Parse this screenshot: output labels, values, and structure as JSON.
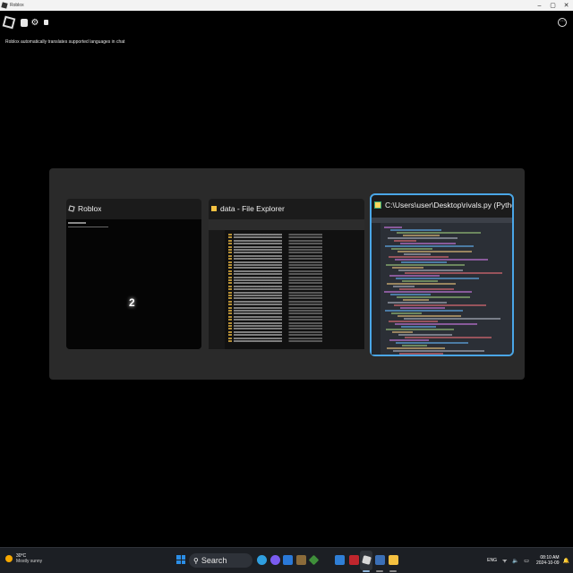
{
  "window": {
    "title": "Roblox",
    "controls": {
      "minimize": "–",
      "maximize": "▢",
      "close": "✕"
    }
  },
  "roblox_topbar": {
    "icons": [
      "roblox-menu-icon",
      "chat-icon",
      "settings-icon",
      "backpack-icon",
      "more-icon"
    ],
    "more_glyph": "⋯"
  },
  "notice": "Roblox automatically translates supported languages in chat",
  "task_switcher": {
    "cards": [
      {
        "title": "Roblox",
        "preview_number": "2"
      },
      {
        "title": "data - File Explorer"
      },
      {
        "title": "C:\\Users\\user\\Desktop\\rivals.py (Python-Mon..."
      }
    ]
  },
  "taskbar": {
    "weather": {
      "temperature": "30°C",
      "condition": "Mostly sunny"
    },
    "search_label": "Search",
    "search_icon": "⚲",
    "tray": {
      "language": "ENG",
      "system_icons": "ᯤ 🔈 ▭",
      "time": "08:10 AM",
      "date": "2024-10-09"
    },
    "colors": {
      "accent": "#4aa6e6",
      "background": "#1c1f24"
    }
  }
}
